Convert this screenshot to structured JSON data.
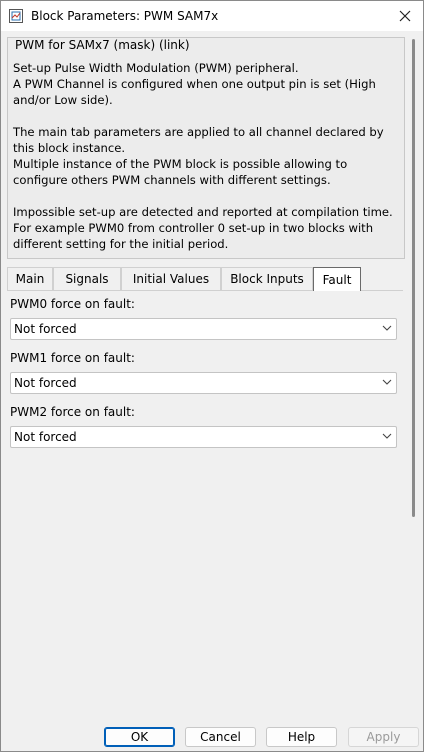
{
  "window": {
    "title": "Block Parameters: PWM SAM7x"
  },
  "description": {
    "header": "PWM for SAMx7 (mask) (link)",
    "text": "Set-up Pulse Width Modulation (PWM) peripheral.\nA PWM Channel is configured when one output pin is set (High and/or Low side).\n\nThe main tab parameters are applied to all channel declared by this block instance.\nMultiple instance of the PWM block is possible allowing to configure others PWM channels with different settings.\n\nImpossible set-up are detected and reported at compilation time. For example PWM0 from controller 0 set-up in two blocks with different setting for the initial period."
  },
  "tabs": [
    {
      "label": "Main"
    },
    {
      "label": "Signals"
    },
    {
      "label": "Initial Values"
    },
    {
      "label": "Block Inputs"
    },
    {
      "label": "Fault"
    }
  ],
  "active_tab": "Fault",
  "fault": {
    "pwm0": {
      "label": "PWM0 force on fault:",
      "value": "Not forced"
    },
    "pwm1": {
      "label": "PWM1 force on fault:",
      "value": "Not forced"
    },
    "pwm2": {
      "label": "PWM2 force on fault:",
      "value": "Not forced"
    }
  },
  "buttons": {
    "ok": "OK",
    "cancel": "Cancel",
    "help": "Help",
    "apply": "Apply"
  },
  "icons": {
    "app": "simulink-block-icon",
    "close": "close-icon",
    "dropdown": "chevron-down-icon"
  },
  "colors": {
    "accent": "#005fb8",
    "background": "#f0f0f0"
  }
}
